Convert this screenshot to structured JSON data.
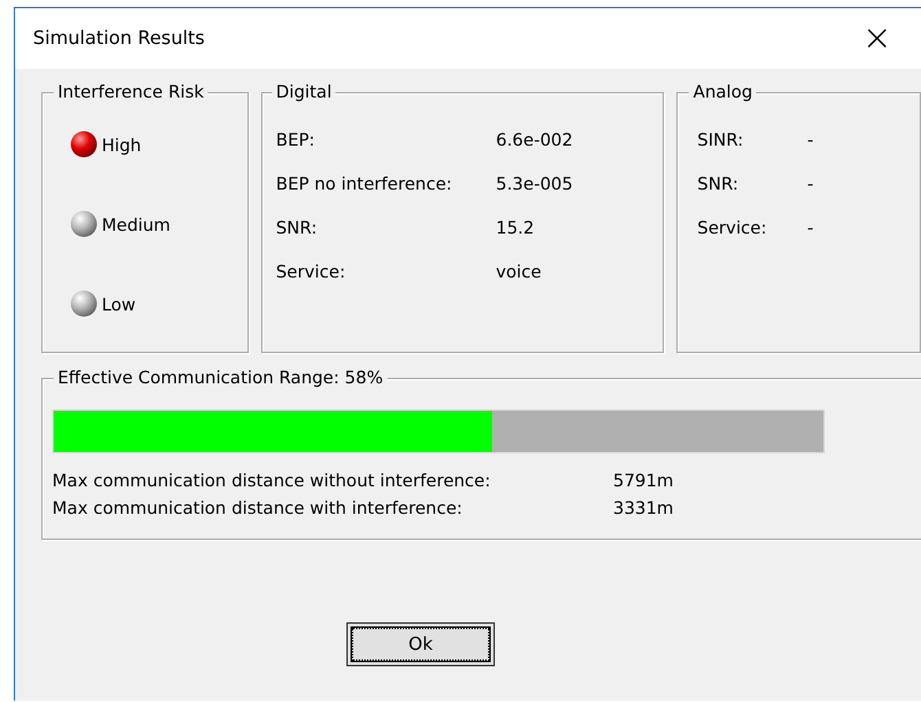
{
  "window": {
    "title": "Simulation Results",
    "close": "×"
  },
  "interference_risk": {
    "title": "Interference Risk",
    "levels": [
      {
        "label": "High",
        "selected": true
      },
      {
        "label": "Medium",
        "selected": false
      },
      {
        "label": "Low",
        "selected": false
      }
    ]
  },
  "digital": {
    "title": "Digital",
    "rows": [
      {
        "label": "BEP:",
        "value": "6.6e-002"
      },
      {
        "label": "BEP no interference:",
        "value": "5.3e-005"
      },
      {
        "label": "SNR:",
        "value": "15.2"
      },
      {
        "label": "Service:",
        "value": "voice"
      }
    ]
  },
  "analog": {
    "title": "Analog",
    "rows": [
      {
        "label": "SINR:",
        "value": "-"
      },
      {
        "label": "SNR:",
        "value": "-"
      },
      {
        "label": "Service:",
        "value": "-"
      }
    ]
  },
  "range": {
    "title": "Effective Communication Range: 58%",
    "level": 0.57,
    "rows": [
      {
        "label": "Max communication distance without interference:",
        "value": "5791m"
      },
      {
        "label": "Max communication distance with interference:",
        "value": "3331m"
      }
    ]
  },
  "buttons": [
    {
      "label": "Ok"
    }
  ]
}
